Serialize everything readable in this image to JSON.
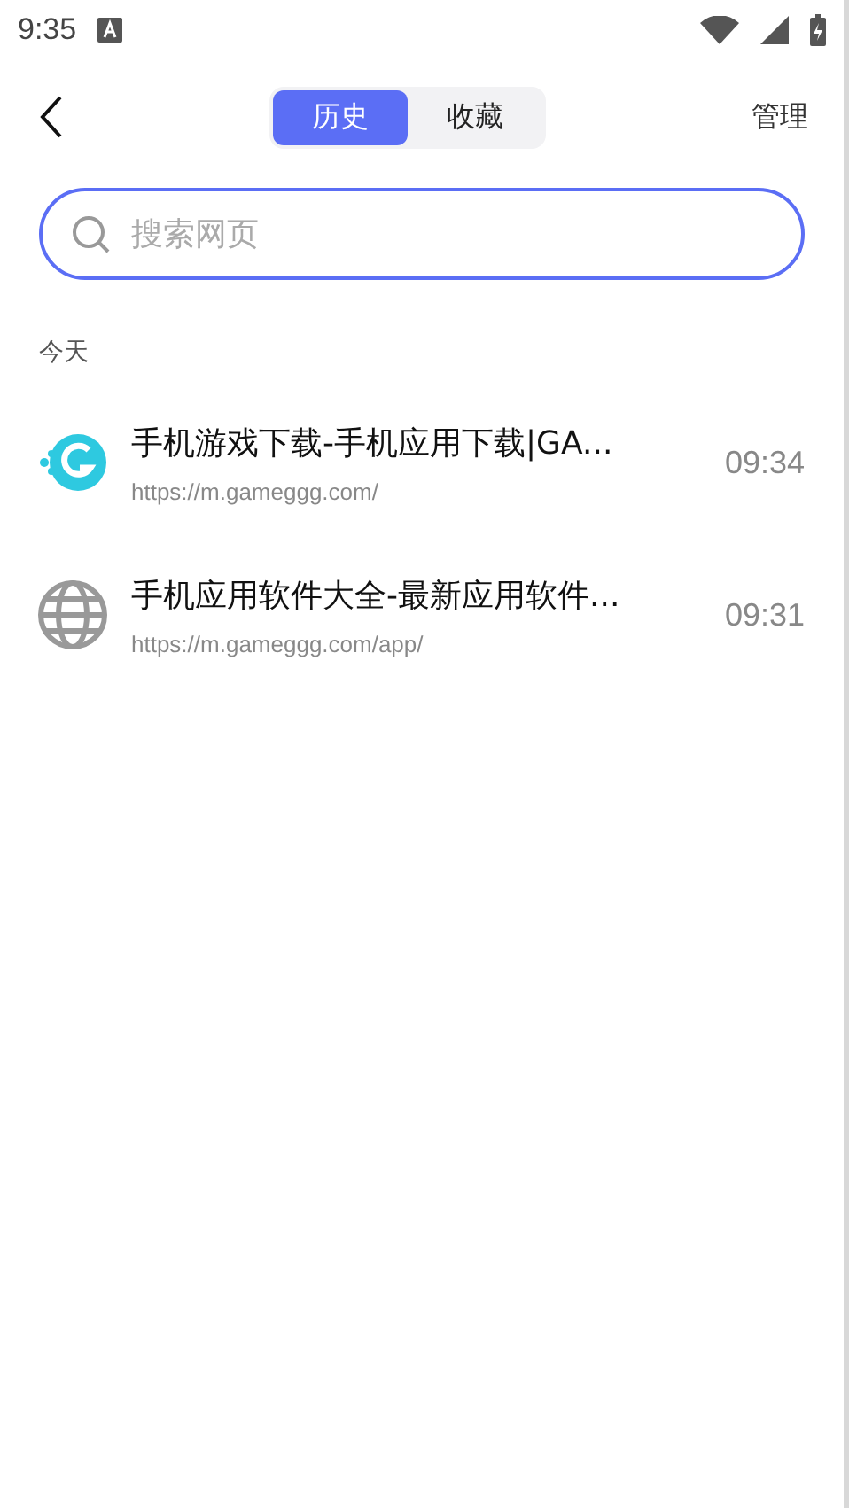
{
  "status_bar": {
    "time": "9:35"
  },
  "tabs": [
    {
      "label": "历史",
      "selected": true
    },
    {
      "label": "收藏",
      "selected": false
    }
  ],
  "manage": "管理",
  "search": {
    "placeholder": "搜索网页"
  },
  "section": "今天",
  "history": [
    {
      "kind": "game",
      "title": "手机游戏下载-手机应用下载|GA...",
      "url": "https://m.gameggg.com/",
      "time": "09:34"
    },
    {
      "kind": "globe",
      "title": "手机应用软件大全-最新应用软件...",
      "url": "https://m.gameggg.com/app/",
      "time": "09:31"
    }
  ]
}
